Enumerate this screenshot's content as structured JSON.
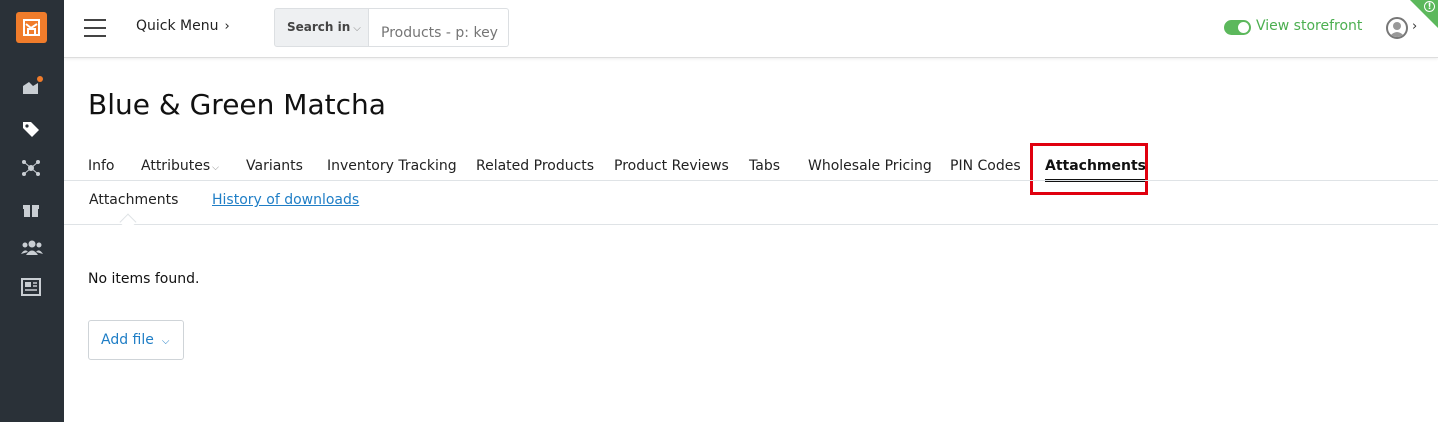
{
  "header": {
    "quick_menu_label": "Quick Menu",
    "search_scope_label": "Search in",
    "search_placeholder": "Products - p: key",
    "storefront_label": "View storefront"
  },
  "product": {
    "title": "Blue & Green Matcha"
  },
  "tabs": [
    {
      "label": "Info"
    },
    {
      "label": "Attributes"
    },
    {
      "label": "Variants"
    },
    {
      "label": "Inventory Tracking"
    },
    {
      "label": "Related Products"
    },
    {
      "label": "Product Reviews"
    },
    {
      "label": "Tabs"
    },
    {
      "label": "Wholesale Pricing"
    },
    {
      "label": "PIN Codes"
    },
    {
      "label": "Attachments",
      "active": true
    }
  ],
  "subtabs": [
    {
      "label": "Attachments"
    },
    {
      "label": "History of downloads"
    }
  ],
  "content": {
    "empty_message": "No items found.",
    "add_file_label": "Add file"
  },
  "colors": {
    "sidebar": "#2a3138",
    "brand": "#f07c2b",
    "storefront": "#4caf50",
    "link": "#1f7ec6",
    "highlight": "#e0000f"
  },
  "icons": [
    "store-logo-icon",
    "dashboard-icon",
    "tags-icon",
    "network-icon",
    "gift-icon",
    "users-icon",
    "content-icon",
    "user-avatar-icon"
  ]
}
